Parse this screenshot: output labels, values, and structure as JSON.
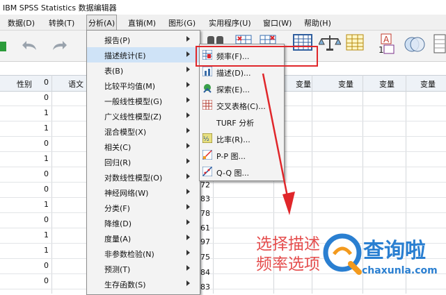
{
  "window": {
    "title": "IBM SPSS Statistics 数据编辑器"
  },
  "menubar": {
    "items": [
      "数据(D)",
      "转换(T)",
      "分析(A)",
      "直销(M)",
      "图形(G)",
      "实用程序(U)",
      "窗口(W)",
      "帮助(H)"
    ]
  },
  "grid": {
    "headers": [
      "性别",
      "语文"
    ],
    "var_label": "变量",
    "gender_values": [
      "0",
      "0",
      "1",
      "1",
      "0",
      "1",
      "0",
      "0",
      "1",
      "0",
      "1",
      "1",
      "0",
      "0"
    ],
    "mid_values": [
      "72",
      "83",
      "78",
      "61",
      "97",
      "75",
      "84",
      "83"
    ]
  },
  "analyze_menu": {
    "items": [
      "报告(P)",
      "描述统计(E)",
      "表(B)",
      "比较平均值(M)",
      "一般线性模型(G)",
      "广义线性模型(Z)",
      "混合模型(X)",
      "相关(C)",
      "回归(R)",
      "对数线性模型(O)",
      "神经网络(W)",
      "分类(F)",
      "降维(D)",
      "度量(A)",
      "非参数检验(N)",
      "预测(T)",
      "生存函数(S)"
    ]
  },
  "descriptive_menu": {
    "items": [
      {
        "label": "频率(F)...",
        "icon": "frequencies-icon"
      },
      {
        "label": "描述(D)...",
        "icon": "descriptives-icon"
      },
      {
        "label": "探索(E)...",
        "icon": "explore-icon"
      },
      {
        "label": "交叉表格(C)...",
        "icon": "crosstabs-icon"
      },
      {
        "label": "TURF 分析",
        "icon": ""
      },
      {
        "label": "比率(R)...",
        "icon": "ratio-icon"
      },
      {
        "label": "P-P 图...",
        "icon": "pp-plot-icon"
      },
      {
        "label": "Q-Q 图...",
        "icon": "qq-plot-icon"
      }
    ]
  },
  "annotation": {
    "line1": "选择描述",
    "line2": "频率选项"
  },
  "watermark": {
    "brand": "查询啦",
    "url": "chaxunla.com"
  },
  "colors": {
    "accent": "#e0262a",
    "highlight": "#cfe3f7",
    "logo_blue": "#2a7fd1",
    "logo_orange": "#f39a1e"
  }
}
